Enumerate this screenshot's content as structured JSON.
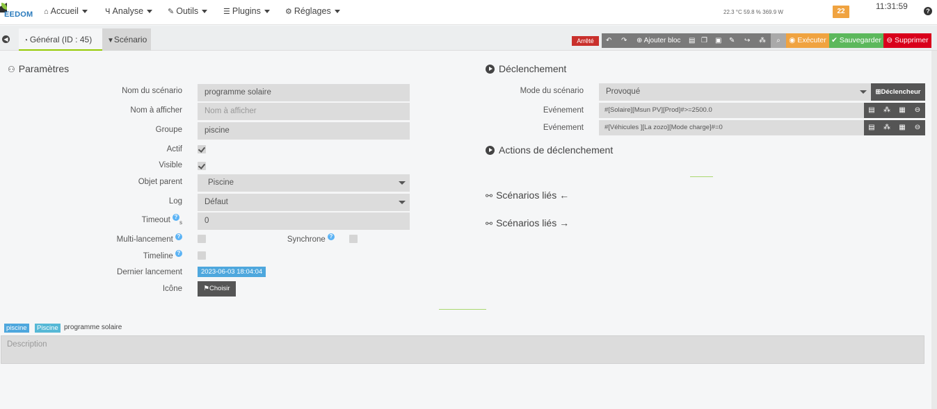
{
  "navbar": {
    "logo": "EEDOM",
    "items": [
      {
        "label": "Accueil",
        "icon": "home-icon"
      },
      {
        "label": "Analyse",
        "icon": "stethoscope-icon"
      },
      {
        "label": "Outils",
        "icon": "wrench-icon"
      },
      {
        "label": "Plugins",
        "icon": "list-icon"
      },
      {
        "label": "Réglages",
        "icon": "gear-icon"
      }
    ],
    "status": "22.3 °C  59.8 %  369.9 W",
    "badge": "22",
    "clock": "11:31:59",
    "help_icon": "?"
  },
  "tabs": {
    "general": "Général (ID : 45)",
    "scenario": "Scénario"
  },
  "toolbar": {
    "state": "Arrêté",
    "add_block": "Ajouter bloc",
    "execute": "Exécuter",
    "save": "Sauvegarder",
    "delete": "Supprimer"
  },
  "params": {
    "title": "Paramètres",
    "name_label": "Nom du scénario",
    "name_value": "programme solaire",
    "display_label": "Nom à afficher",
    "display_placeholder": "Nom à afficher",
    "group_label": "Groupe",
    "group_value": "piscine",
    "active_label": "Actif",
    "visible_label": "Visible",
    "parent_label": "Objet parent",
    "parent_value": "Piscine",
    "log_label": "Log",
    "log_value": "Défaut",
    "timeout_label": "Timeout",
    "timeout_unit": "s",
    "timeout_value": "0",
    "multi_label": "Multi-lancement",
    "sync_label": "Synchrone",
    "timeline_label": "Timeline",
    "last_run_label": "Dernier lancement",
    "last_run_value": "2023-06-03 18:04:04",
    "icon_label": "Icône",
    "choose_button": "Choisir"
  },
  "trigger": {
    "title": "Déclenchement",
    "mode_label": "Mode du scénario",
    "mode_value": "Provoqué",
    "add_trigger_button": "Déclencheur",
    "events": [
      {
        "label": "Evénement",
        "value": "#[Solaire][Msun PV][Prod]#>=2500.0"
      },
      {
        "label": "Evénement",
        "value": "#[Véhicules ][La zozo][Mode charge]#=0"
      }
    ],
    "actions_title": "Actions de déclenchement",
    "linked_in_title": "Scénarios liés",
    "linked_out_title": "Scénarios liés"
  },
  "footer": {
    "tag1": "piscine",
    "tag2": "Piscine",
    "scenario_name": "programme solaire",
    "description_placeholder": "Description"
  }
}
